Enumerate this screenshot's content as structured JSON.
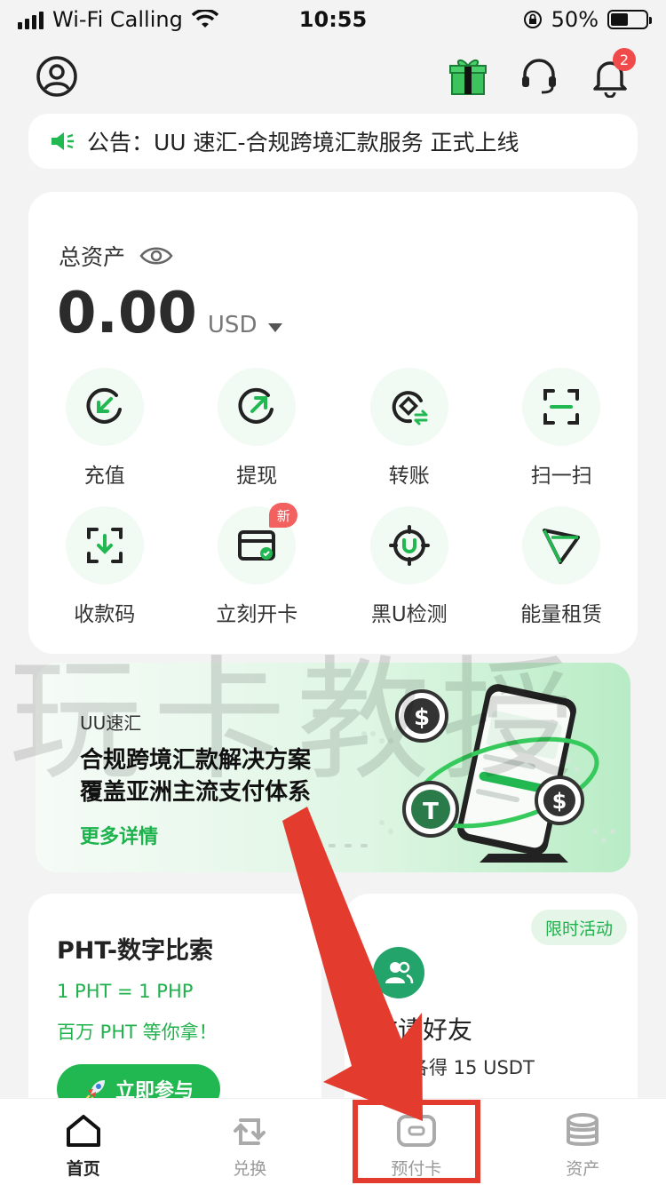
{
  "status_bar": {
    "carrier": "Wi-Fi Calling",
    "time": "10:55",
    "battery": "50%"
  },
  "header": {
    "notification_count": "2"
  },
  "announcement": {
    "text": "公告：UU 速汇-合规跨境汇款服务 正式上线"
  },
  "assets": {
    "label": "总资产",
    "amount": "0.00",
    "currency": "USD"
  },
  "actions": [
    {
      "label": "充值"
    },
    {
      "label": "提现"
    },
    {
      "label": "转账"
    },
    {
      "label": "扫一扫"
    },
    {
      "label": "收款码"
    },
    {
      "label": "立刻开卡",
      "badge": "新"
    },
    {
      "label": "黑U检测"
    },
    {
      "label": "能量租赁"
    }
  ],
  "banner": {
    "brand": "UU速汇",
    "line1": "合规跨境汇款解决方案",
    "line2": "覆盖亚洲主流支付体系",
    "more": "更多详情"
  },
  "pht_card": {
    "title": "PHT-数字比索",
    "line1": "1 PHT = 1 PHP",
    "line2": "百万 PHT 等你拿！",
    "button": "立即参与"
  },
  "invite_card": {
    "tag": "限时活动",
    "title": "邀请好友",
    "subtitle": "双方各得 15 USDT"
  },
  "bottom_nav": [
    {
      "label": "首页"
    },
    {
      "label": "兑换"
    },
    {
      "label": "预付卡"
    },
    {
      "label": "资产"
    }
  ],
  "watermark": "玩卡教授",
  "colors": {
    "brand_green": "#22b851",
    "annotation_red": "#e33b2e"
  }
}
